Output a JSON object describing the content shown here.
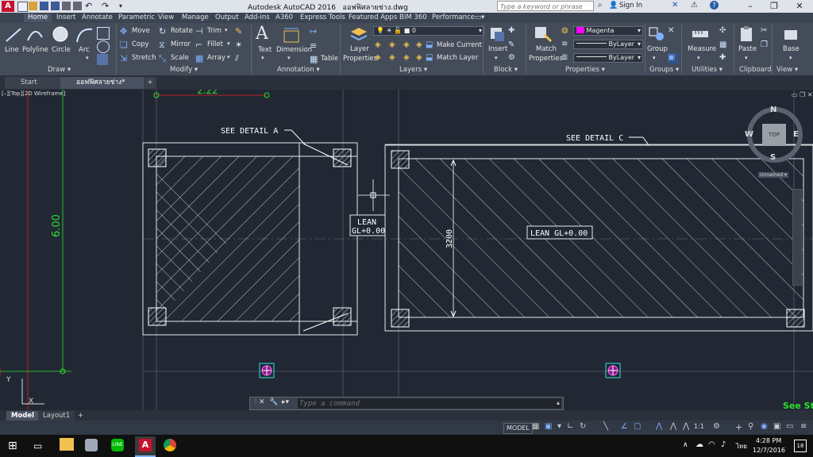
{
  "titlebar": {
    "app_title": "Autodesk AutoCAD 2016",
    "file_name": "ออฟฟิศลายช่าง.dwg",
    "search_placeholder": "Type a keyword or phrase",
    "sign_in": "Sign In"
  },
  "ribbon_tabs": [
    "Home",
    "Insert",
    "Annotate",
    "Parametric",
    "View",
    "Manage",
    "Output",
    "Add-ins",
    "A360",
    "Express Tools",
    "Featured Apps",
    "BIM 360",
    "Performance"
  ],
  "ribbon": {
    "draw": {
      "title": "Draw",
      "line": "Line",
      "polyline": "Polyline",
      "circle": "Circle",
      "arc": "Arc"
    },
    "modify": {
      "title": "Modify",
      "move": "Move",
      "rotate": "Rotate",
      "trim": "Trim",
      "copy": "Copy",
      "mirror": "Mirror",
      "fillet": "Fillet",
      "stretch": "Stretch",
      "scale": "Scale",
      "array": "Array"
    },
    "annotation": {
      "title": "Annotation",
      "text": "Text",
      "dimension": "Dimension",
      "table": "Table"
    },
    "layers": {
      "title": "Layers",
      "layer_properties_1": "Layer",
      "layer_properties_2": "Properties",
      "layer_value": "0",
      "make_current": "Make Current",
      "match_layer": "Match Layer"
    },
    "block": {
      "title": "Block",
      "insert": "Insert"
    },
    "properties": {
      "title": "Properties",
      "match_1": "Match",
      "match_2": "Properties",
      "color": "Magenta",
      "linetype": "ByLayer",
      "lineweight": "ByLayer"
    },
    "groups": {
      "title": "Groups",
      "group": "Group"
    },
    "utilities": {
      "title": "Utilities",
      "measure": "Measure"
    },
    "clipboard": {
      "title": "Clipboard",
      "paste": "Paste"
    },
    "view": {
      "title": "View",
      "base": "Base"
    }
  },
  "doc_tabs": {
    "start": "Start",
    "file": "ออฟฟิศลายช่าง*"
  },
  "canvas": {
    "view_label": "[–][Top][2D Wireframe]",
    "see_detail_a": "SEE DETAIL A",
    "see_detail_c": "SEE DETAIL C",
    "lean_1": "LEAN",
    "lean_2": "GL+0.00",
    "lean_main": "LEAN GL+0.00",
    "dim_vertical": "3200",
    "dim_green_vertical": "6.00",
    "dim_top": "2.22",
    "corner_text": "See St",
    "viewcube": {
      "n": "N",
      "s": "S",
      "e": "E",
      "w": "W",
      "top": "TOP",
      "unnamed": "Unnamed"
    },
    "ucs_x": "X",
    "ucs_y": "Y"
  },
  "command_line": {
    "placeholder": "Type a command"
  },
  "layout_tabs": [
    "Model",
    "Layout1"
  ],
  "statusbar": {
    "model": "MODEL",
    "scale": "1:1"
  },
  "taskbar": {
    "time": "4:28 PM",
    "date": "12/7/2016",
    "lang": "ไทย",
    "notif": "18"
  },
  "colors": {
    "accent_red": "#c8102e",
    "magenta": "#ff00ff",
    "cad_green": "#2ee02e",
    "cad_bg": "#212833"
  }
}
